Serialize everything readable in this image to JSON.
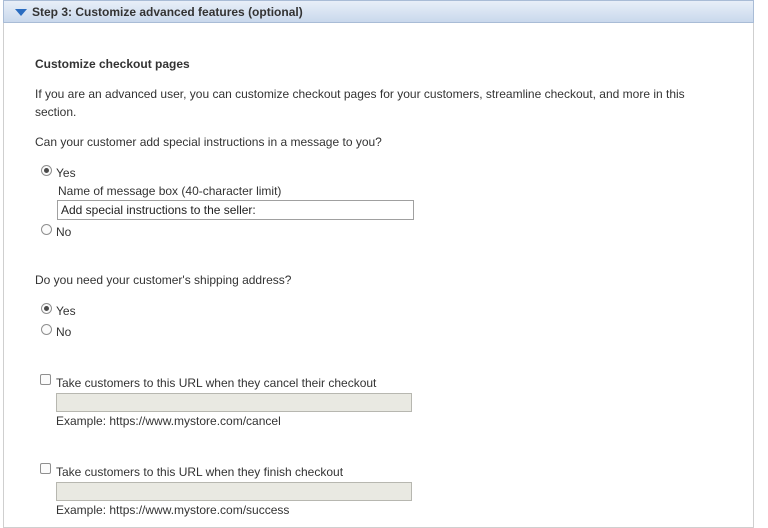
{
  "header": {
    "title": "Step 3: Customize advanced features (optional)",
    "toggle_icon": "triangle-down-icon"
  },
  "section": {
    "heading": "Customize checkout pages",
    "intro_line1": "If you are an advanced user, you can customize checkout pages for your customers, streamline checkout, and more in this",
    "intro_line2": "section."
  },
  "special_instructions": {
    "question": "Can your customer add special instructions in a message to you?",
    "yes_label": "Yes",
    "no_label": "No",
    "selected": "Yes",
    "box_label": "Name of message box (40-character limit)",
    "box_value": "Add special instructions to the seller:"
  },
  "shipping": {
    "question": "Do you need your customer's shipping address?",
    "yes_label": "Yes",
    "no_label": "No",
    "selected": "Yes"
  },
  "cancel_url": {
    "label": "Take customers to this URL when they cancel their checkout",
    "checked": false,
    "value": "",
    "example": "Example: https://www.mystore.com/cancel"
  },
  "success_url": {
    "label": "Take customers to this URL when they finish checkout",
    "checked": false,
    "value": "",
    "example": "Example: https://www.mystore.com/success"
  },
  "colors": {
    "header_accent": "#2a6cc0",
    "disabled_input_bg": "#e9e9e2"
  }
}
